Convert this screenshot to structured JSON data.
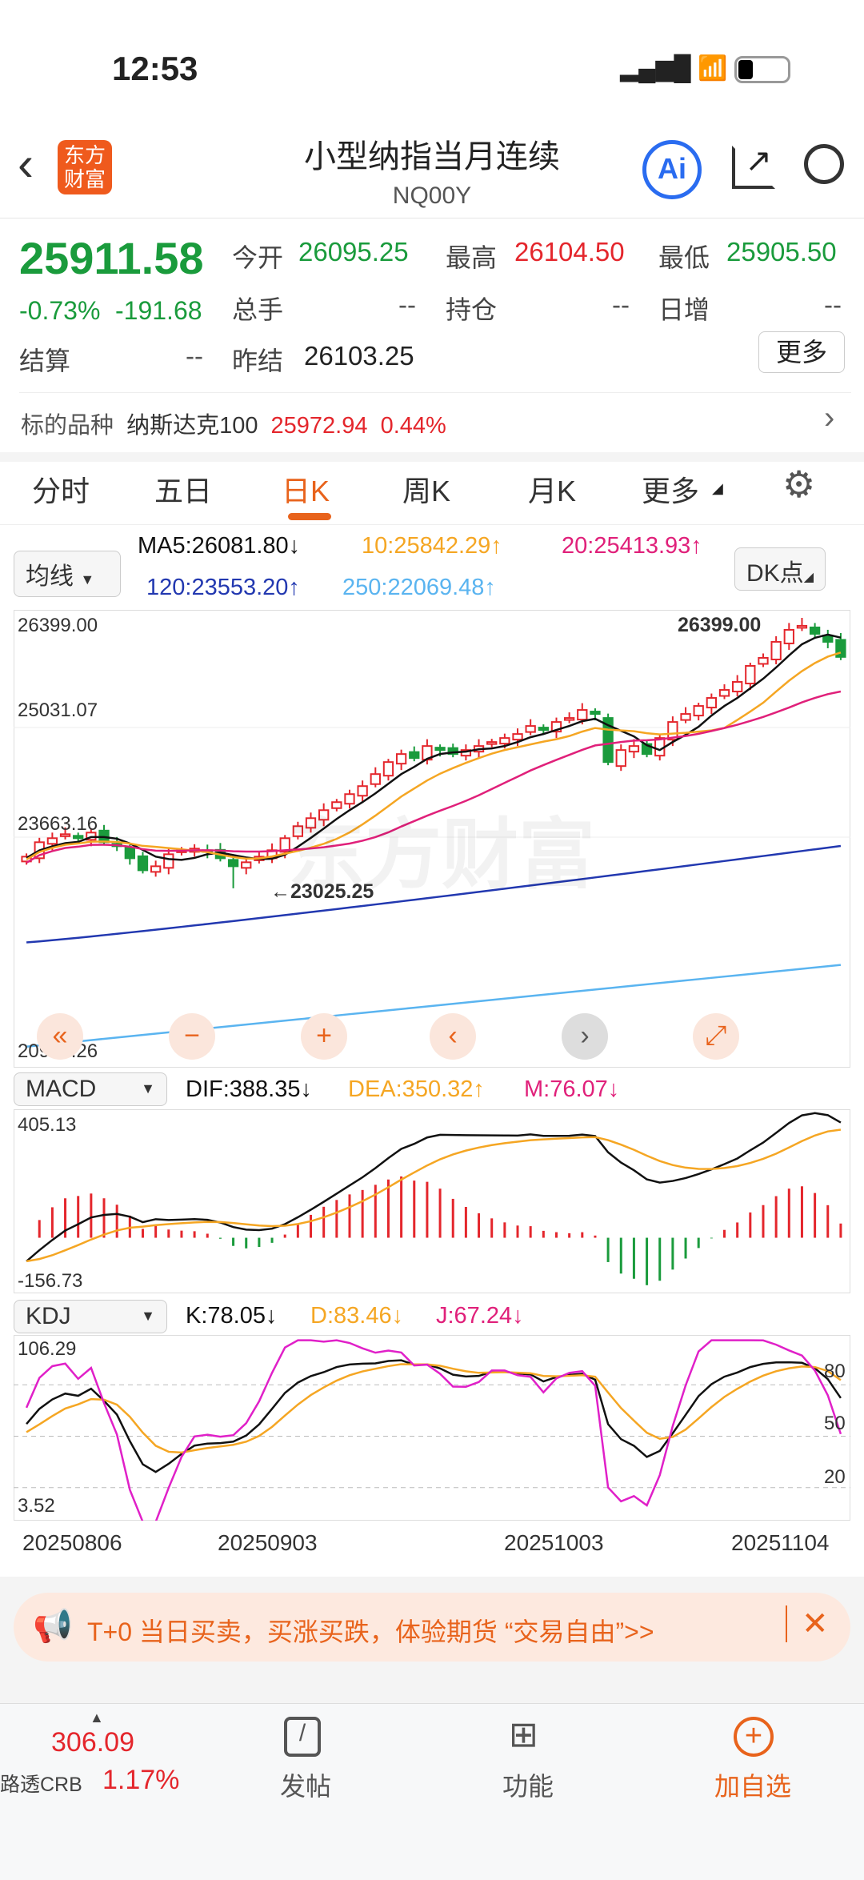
{
  "status": {
    "time": "12:53"
  },
  "header": {
    "logo": "东方财富",
    "title": "小型纳指当月连续",
    "code": "NQ00Y",
    "ai": "Ai"
  },
  "quote": {
    "price": "25911.58",
    "pct": "-0.73%",
    "chg": "-191.68",
    "open_label": "今开",
    "open": "26095.25",
    "high_label": "最高",
    "high": "26104.50",
    "low_label": "最低",
    "low": "25905.50",
    "vol_label": "总手",
    "vol": "--",
    "oi_label": "持仓",
    "oi": "--",
    "inc_label": "日增",
    "inc": "--",
    "settle_label": "结算",
    "settle": "--",
    "prev_label": "昨结",
    "prev": "26103.25",
    "more": "更多"
  },
  "underlying": {
    "label": "标的品种",
    "name": "纳斯达克100",
    "price": "25972.94",
    "pct": "0.44%"
  },
  "tabs": [
    "分时",
    "五日",
    "日K",
    "周K",
    "月K",
    "更多"
  ],
  "active_tab": 2,
  "ma": {
    "select": "均线",
    "ma5": "MA5:26081.80↓",
    "ma10": "10:25842.29↑",
    "ma20": "20:25413.93↑",
    "ma120": "120:23553.20↑",
    "ma250": "250:22069.48↑",
    "dk": "DK点"
  },
  "colors": {
    "up": "#e4262c",
    "down": "#1a9b3c",
    "ma5": "#111111",
    "ma10": "#f5a623",
    "ma20": "#e0207a",
    "ma120": "#2238b0",
    "ma250": "#5ab4f0",
    "accent": "#e8631c"
  },
  "main_axis": {
    "top": "26399.00",
    "mid": "25031.07",
    "low": "23663.16",
    "bottom": "20927.26",
    "max_label": "26399.00",
    "min_label": "←23025.25"
  },
  "watermark": "东方财富",
  "macd": {
    "select": "MACD",
    "dif": "DIF:388.35↓",
    "dea": "DEA:350.32↑",
    "m": "M:76.07↓",
    "top": "405.13",
    "bottom": "-156.73"
  },
  "kdj": {
    "select": "KDJ",
    "k": "K:78.05↓",
    "d": "D:83.46↓",
    "j": "J:67.24↓",
    "top": "106.29",
    "bottom": "3.52",
    "lines": [
      "80",
      "50",
      "20"
    ]
  },
  "dates": [
    "20250806",
    "20250903",
    "20251003",
    "20251104"
  ],
  "banner": {
    "text": "T+0 当日买卖，买涨买跌，体验期货 “交易自由”>>"
  },
  "bottom": {
    "crb_price": "306.09",
    "crb_name": "路透CRB",
    "crb_pct": "1.17%",
    "post": "发帖",
    "func": "功能",
    "add": "加自选"
  },
  "chart_data": {
    "type": "candlestick",
    "ylim": [
      20927.26,
      26399
    ],
    "closes": [
      23420,
      23600,
      23650,
      23700,
      23650,
      23720,
      23600,
      23550,
      23400,
      23250,
      23300,
      23450,
      23500,
      23520,
      23480,
      23400,
      23300,
      23350,
      23420,
      23500,
      23650,
      23800,
      23900,
      24000,
      24100,
      24200,
      24300,
      24450,
      24600,
      24700,
      24650,
      24800,
      24750,
      24700,
      24750,
      24800,
      24850,
      24900,
      24950,
      25050,
      25000,
      25100,
      25150,
      25250,
      25200,
      24600,
      24750,
      24800,
      24700,
      24900,
      25100,
      25200,
      25300,
      25400,
      25500,
      25600,
      25800,
      25900,
      26100,
      26250,
      26300,
      26200,
      26100,
      25911.58
    ],
    "ma120": [
      22350,
      23553.2
    ],
    "ma250": [
      21050,
      22069.48
    ]
  }
}
